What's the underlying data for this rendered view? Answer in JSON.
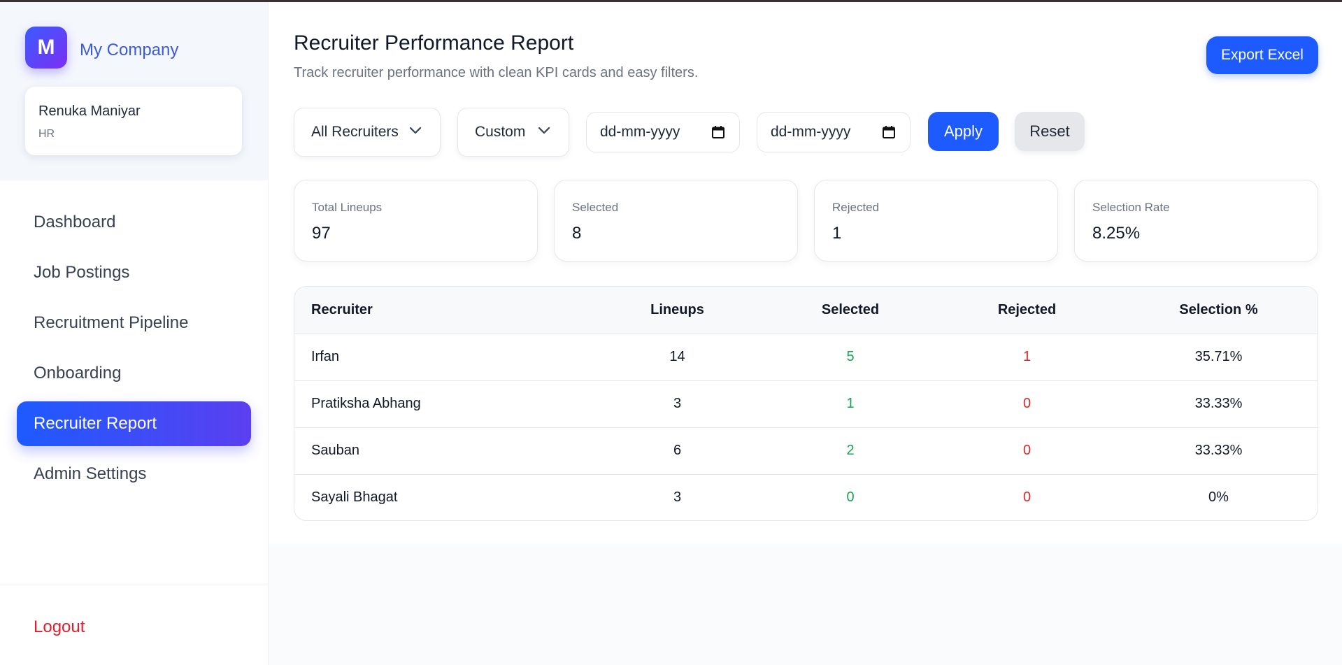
{
  "sidebar": {
    "logo_letter": "M",
    "company": "My Company",
    "user": {
      "name": "Renuka Maniyar",
      "role": "HR"
    },
    "nav": [
      {
        "label": "Dashboard",
        "active": false
      },
      {
        "label": "Job Postings",
        "active": false
      },
      {
        "label": "Recruitment Pipeline",
        "active": false
      },
      {
        "label": "Onboarding",
        "active": false
      },
      {
        "label": "Recruiter Report",
        "active": true
      },
      {
        "label": "Admin Settings",
        "active": false
      }
    ],
    "logout": "Logout"
  },
  "header": {
    "title": "Recruiter Performance Report",
    "subtitle": "Track recruiter performance with clean KPI cards and easy filters.",
    "export_label": "Export Excel"
  },
  "filters": {
    "recruiter": "All Recruiters",
    "range": "Custom",
    "date_from_placeholder": "dd-mm-yyyy",
    "date_to_placeholder": "dd-mm-yyyy",
    "apply_label": "Apply",
    "reset_label": "Reset"
  },
  "kpis": [
    {
      "label": "Total Lineups",
      "value": "97"
    },
    {
      "label": "Selected",
      "value": "8"
    },
    {
      "label": "Rejected",
      "value": "1"
    },
    {
      "label": "Selection Rate",
      "value": "8.25%"
    }
  ],
  "table": {
    "headers": [
      "Recruiter",
      "Lineups",
      "Selected",
      "Rejected",
      "Selection %"
    ],
    "rows": [
      {
        "recruiter": "Irfan",
        "lineups": "14",
        "selected": "5",
        "rejected": "1",
        "rate": "35.71%"
      },
      {
        "recruiter": "Pratiksha Abhang",
        "lineups": "3",
        "selected": "1",
        "rejected": "0",
        "rate": "33.33%"
      },
      {
        "recruiter": "Sauban",
        "lineups": "6",
        "selected": "2",
        "rejected": "0",
        "rate": "33.33%"
      },
      {
        "recruiter": "Sayali Bhagat",
        "lineups": "3",
        "selected": "0",
        "rejected": "0",
        "rate": "0%"
      }
    ]
  },
  "colors": {
    "accent": "#1d5bff",
    "accent_gradient_end": "#5b3ff0",
    "selected_green": "#16a34a",
    "rejected_red": "#dc2626",
    "logout_red": "#e11d2e"
  },
  "icons": {
    "dropdown": "chevron-down-icon",
    "date": "calendar-icon"
  }
}
